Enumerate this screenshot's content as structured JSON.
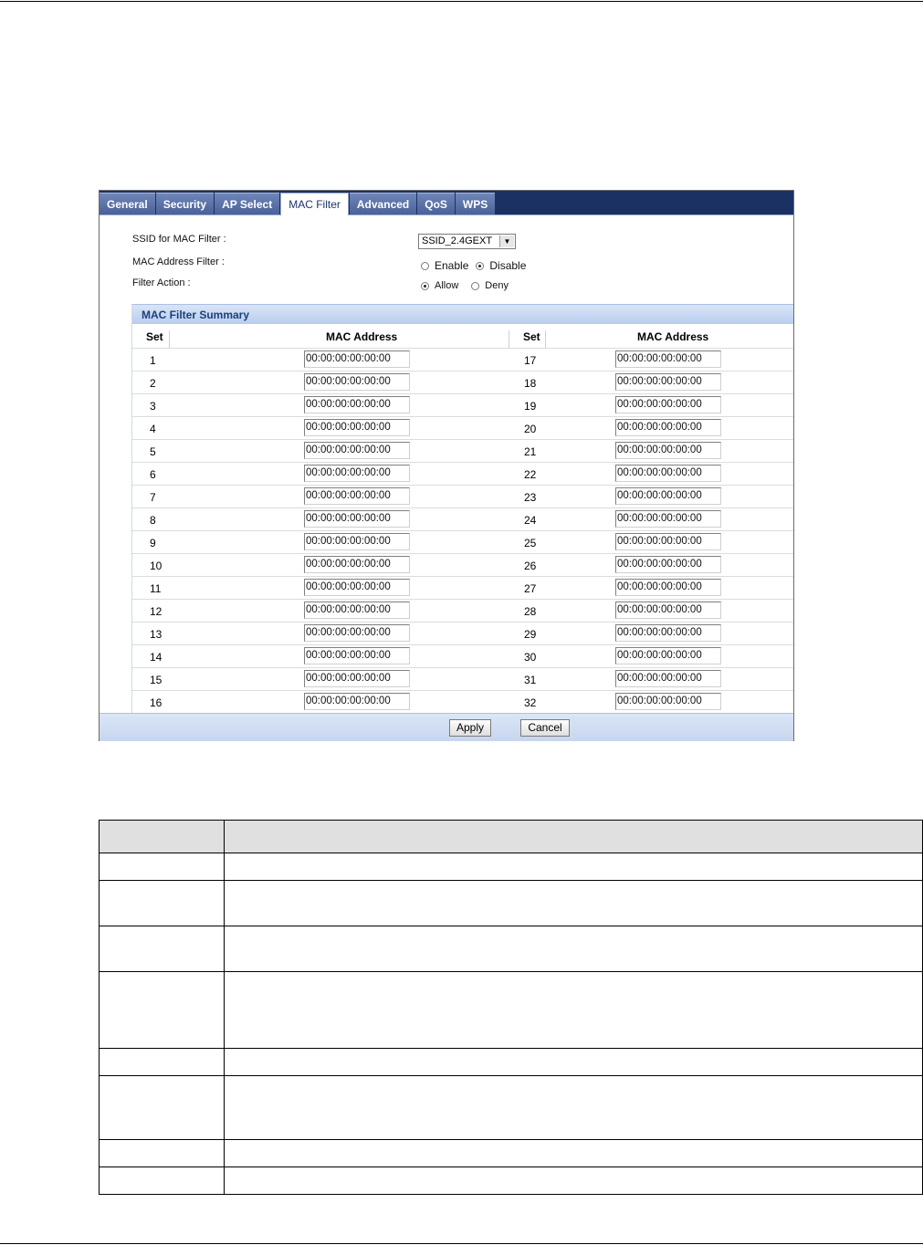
{
  "tabs": [
    {
      "label": "General",
      "active": false
    },
    {
      "label": "Security",
      "active": false
    },
    {
      "label": "AP Select",
      "active": false
    },
    {
      "label": "MAC Filter",
      "active": true
    },
    {
      "label": "Advanced",
      "active": false
    },
    {
      "label": "QoS",
      "active": false
    },
    {
      "label": "WPS",
      "active": false
    }
  ],
  "form": {
    "ssid_label": "SSID for MAC Filter :",
    "ssid_value": "SSID_2.4GEXT",
    "mac_filter_label": "MAC Address Filter :",
    "enable_label": "Enable",
    "disable_label": "Disable",
    "mac_filter_selected": "Disable",
    "action_label": "Filter Action :",
    "allow_label": "Allow",
    "deny_label": "Deny",
    "action_selected": "Allow"
  },
  "summary": {
    "title": "MAC Filter Summary",
    "col_set": "Set",
    "col_mac": "MAC Address",
    "rows": [
      {
        "left_set": "1",
        "left_mac": "00:00:00:00:00:00",
        "right_set": "17",
        "right_mac": "00:00:00:00:00:00"
      },
      {
        "left_set": "2",
        "left_mac": "00:00:00:00:00:00",
        "right_set": "18",
        "right_mac": "00:00:00:00:00:00"
      },
      {
        "left_set": "3",
        "left_mac": "00:00:00:00:00:00",
        "right_set": "19",
        "right_mac": "00:00:00:00:00:00"
      },
      {
        "left_set": "4",
        "left_mac": "00:00:00:00:00:00",
        "right_set": "20",
        "right_mac": "00:00:00:00:00:00"
      },
      {
        "left_set": "5",
        "left_mac": "00:00:00:00:00:00",
        "right_set": "21",
        "right_mac": "00:00:00:00:00:00"
      },
      {
        "left_set": "6",
        "left_mac": "00:00:00:00:00:00",
        "right_set": "22",
        "right_mac": "00:00:00:00:00:00"
      },
      {
        "left_set": "7",
        "left_mac": "00:00:00:00:00:00",
        "right_set": "23",
        "right_mac": "00:00:00:00:00:00"
      },
      {
        "left_set": "8",
        "left_mac": "00:00:00:00:00:00",
        "right_set": "24",
        "right_mac": "00:00:00:00:00:00"
      },
      {
        "left_set": "9",
        "left_mac": "00:00:00:00:00:00",
        "right_set": "25",
        "right_mac": "00:00:00:00:00:00"
      },
      {
        "left_set": "10",
        "left_mac": "00:00:00:00:00:00",
        "right_set": "26",
        "right_mac": "00:00:00:00:00:00"
      },
      {
        "left_set": "11",
        "left_mac": "00:00:00:00:00:00",
        "right_set": "27",
        "right_mac": "00:00:00:00:00:00"
      },
      {
        "left_set": "12",
        "left_mac": "00:00:00:00:00:00",
        "right_set": "28",
        "right_mac": "00:00:00:00:00:00"
      },
      {
        "left_set": "13",
        "left_mac": "00:00:00:00:00:00",
        "right_set": "29",
        "right_mac": "00:00:00:00:00:00"
      },
      {
        "left_set": "14",
        "left_mac": "00:00:00:00:00:00",
        "right_set": "30",
        "right_mac": "00:00:00:00:00:00"
      },
      {
        "left_set": "15",
        "left_mac": "00:00:00:00:00:00",
        "right_set": "31",
        "right_mac": "00:00:00:00:00:00"
      },
      {
        "left_set": "16",
        "left_mac": "00:00:00:00:00:00",
        "right_set": "32",
        "right_mac": "00:00:00:00:00:00"
      }
    ]
  },
  "buttons": {
    "apply": "Apply",
    "cancel": "Cancel"
  }
}
